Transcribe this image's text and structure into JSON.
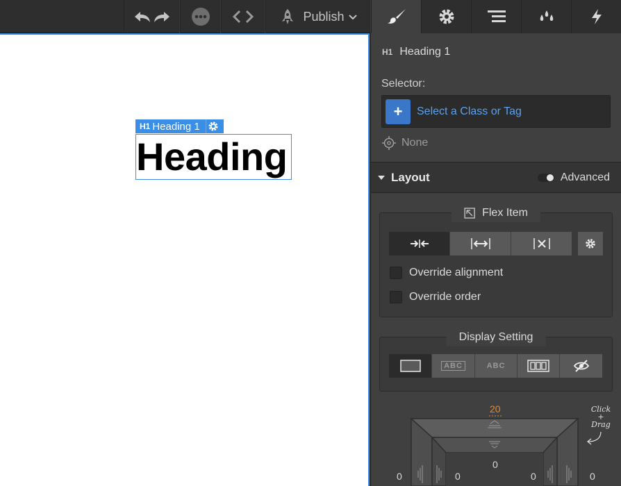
{
  "toolbar": {
    "undo_icon": "undo-icon",
    "redo_icon": "redo-icon",
    "more_icon": "ellipsis-icon",
    "code_icon": "code-brackets-icon",
    "publish_label": "Publish",
    "publish_icon": "rocket-icon"
  },
  "canvas": {
    "selection_tag": {
      "badge": "H1",
      "name": "Heading 1"
    },
    "heading_text": "Heading",
    "accent_color": "#3a8ee6"
  },
  "panel_tabs": [
    {
      "name": "style-tab",
      "icon": "paintbrush-icon",
      "active": true
    },
    {
      "name": "settings-tab",
      "icon": "gear-icon",
      "active": false
    },
    {
      "name": "navigator-tab",
      "icon": "layers-icon",
      "active": false
    },
    {
      "name": "swatches-tab",
      "icon": "droplets-icon",
      "active": false
    },
    {
      "name": "interactions-tab",
      "icon": "lightning-icon",
      "active": false
    }
  ],
  "style_panel": {
    "element_badge": "H1",
    "element_name": "Heading 1",
    "selector_label": "Selector:",
    "selector_placeholder": "Select a Class or Tag",
    "selector_add": "+",
    "state_label": "None",
    "layout": {
      "title": "Layout",
      "advanced_label": "Advanced",
      "advanced_on": true,
      "flex_item": {
        "title": "Flex Item",
        "sizing_options": [
          "shrink-icon",
          "grow-icon",
          "none-icon"
        ],
        "selected_sizing": 0,
        "override_alignment": "Override alignment",
        "override_order": "Override order"
      },
      "display_setting": {
        "title": "Display Setting",
        "options": [
          {
            "icon": "block-icon",
            "label": ""
          },
          {
            "icon": "inline-block-icon",
            "label": "ABC"
          },
          {
            "icon": "inline-icon",
            "label": "ABC"
          },
          {
            "icon": "flex-icon",
            "label": ""
          },
          {
            "icon": "hidden-eye-icon",
            "label": ""
          }
        ],
        "selected": 0
      }
    },
    "spacing": {
      "margin_top": "20",
      "padding_top": "0",
      "margin_left": "0",
      "padding_left": "0",
      "padding_right": "0",
      "margin_right": "0",
      "hint": "Click + Drag"
    }
  }
}
